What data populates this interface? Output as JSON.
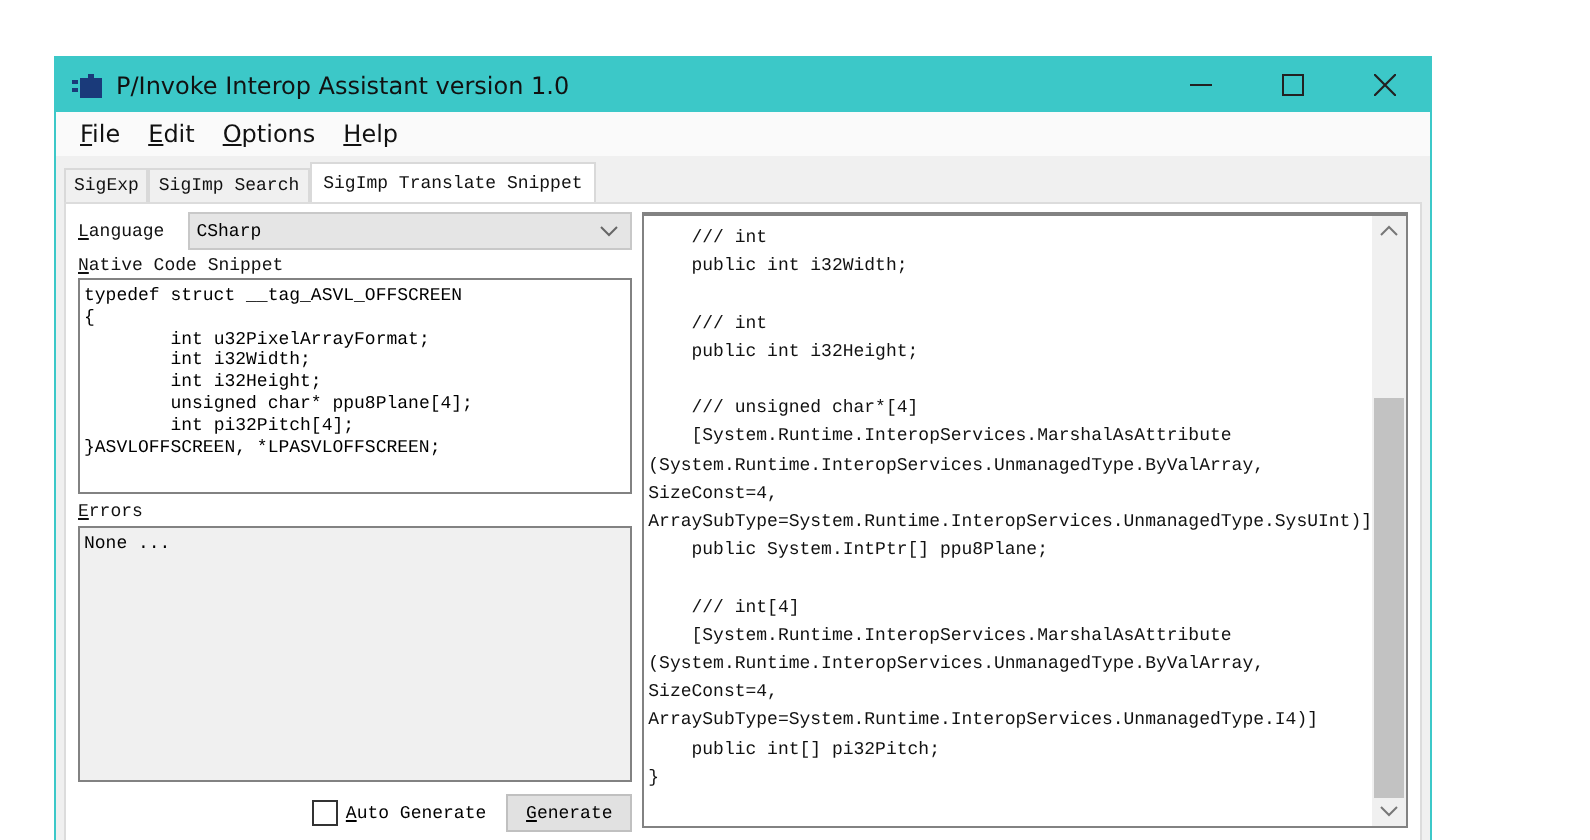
{
  "window": {
    "title": "P/Invoke Interop Assistant version 1.0"
  },
  "menu": [
    {
      "label": "File",
      "mnemonic_underlined": true
    },
    {
      "label": "Edit",
      "mnemonic_underlined": true
    },
    {
      "label": "Options",
      "mnemonic_underlined": true
    },
    {
      "label": "Help",
      "mnemonic_underlined": true
    }
  ],
  "tabs": [
    {
      "label": "SigExp",
      "selected": false
    },
    {
      "label": "SigImp Search",
      "selected": false
    },
    {
      "label": "SigImp Translate Snippet",
      "selected": true
    }
  ],
  "language": {
    "label": "Language",
    "mnemonic_underlined": true,
    "value": "CSharp"
  },
  "native_code": {
    "label": "Native Code Snippet",
    "mnemonic_underlined": true,
    "value": "typedef struct __tag_ASVL_OFFSCREEN\n{\n\tint u32PixelArrayFormat;\n\tint i32Width;\n\tint i32Height;\n\tunsigned char* ppu8Plane[4];\n\tint pi32Pitch[4];\n}ASVLOFFSCREEN, *LPASVLOFFSCREEN;"
  },
  "errors": {
    "label": "Errors",
    "mnemonic_underlined": true,
    "value": "None ..."
  },
  "auto_generate": {
    "label": "Auto Generate",
    "mnemonic_underlined": true,
    "checked": false
  },
  "generate_button": {
    "label": "Generate",
    "mnemonic_underlined": true
  },
  "output_code": "    /// int\n    public int i32Width;\n\n    /// int\n    public int i32Height;\n\n    /// unsigned char*[4]\n    [System.Runtime.InteropServices.MarshalAsAttribute\n(System.Runtime.InteropServices.UnmanagedType.ByValArray,\nSizeConst=4,\nArraySubType=System.Runtime.InteropServices.UnmanagedType.SysUInt)]\n    public System.IntPtr[] ppu8Plane;\n\n    /// int[4]\n    [System.Runtime.InteropServices.MarshalAsAttribute\n(System.Runtime.InteropServices.UnmanagedType.ByValArray,\nSizeConst=4,\nArraySubType=System.Runtime.InteropServices.UnmanagedType.I4)]\n    public int[] pi32Pitch;\n}"
}
